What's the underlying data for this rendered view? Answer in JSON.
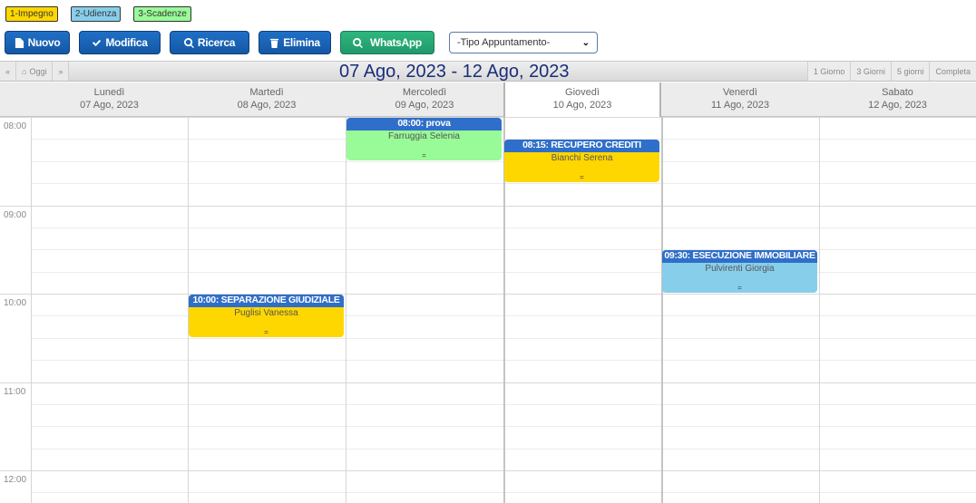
{
  "legend": [
    {
      "label": "1-Impegno",
      "color": "#ffd700"
    },
    {
      "label": "2-Udienza",
      "color": "#87ceeb"
    },
    {
      "label": "3-Scadenze",
      "color": "#98fb98"
    }
  ],
  "toolbar": {
    "nuovo": "Nuovo",
    "modifica": "Modifica",
    "ricerca": "Ricerca",
    "elimina": "Elimina",
    "whatsapp": "WhatsApp",
    "tipo_select": "-Tipo Appuntamento-"
  },
  "nav": {
    "prev": "«",
    "today": "Oggi",
    "next": "»",
    "range_title": "07 Ago, 2023 - 12 Ago, 2023",
    "views": [
      "1 Giorno",
      "3 Giorni",
      "5 giorni",
      "Completa"
    ]
  },
  "days": [
    {
      "name": "Lunedì",
      "date": "07 Ago, 2023"
    },
    {
      "name": "Martedì",
      "date": "08 Ago, 2023"
    },
    {
      "name": "Mercoledì",
      "date": "09 Ago, 2023"
    },
    {
      "name": "Giovedì",
      "date": "10 Ago, 2023",
      "today": true
    },
    {
      "name": "Venerdì",
      "date": "11 Ago, 2023"
    },
    {
      "name": "Sabato",
      "date": "12 Ago, 2023"
    }
  ],
  "hours": [
    "08:00",
    "09:00",
    "10:00",
    "11:00",
    "12:00"
  ],
  "events": [
    {
      "day": 2,
      "start": "08:00",
      "end": "08:30",
      "title": "08:00: prova",
      "name": "Farruggia Selenia",
      "dot": "=",
      "color": "#98fb98"
    },
    {
      "day": 3,
      "start": "08:15",
      "end": "08:45",
      "title": "08:15: RECUPERO CREDITI",
      "name": "Bianchi Serena",
      "dot": "=",
      "color": "#ffd700"
    },
    {
      "day": 4,
      "start": "09:30",
      "end": "10:00",
      "title": "09:30: ESECUZIONE IMMOBILIARE",
      "name": "Pulvirenti Giorgia",
      "dot": "=",
      "color": "#87ceeb"
    },
    {
      "day": 1,
      "start": "10:00",
      "end": "10:30",
      "title": "10:00: SEPARAZIONE GIUDIZIALE",
      "name": "Puglisi Vanessa",
      "dot": "=",
      "color": "#ffd700"
    }
  ]
}
